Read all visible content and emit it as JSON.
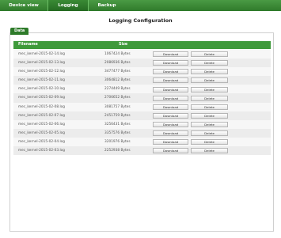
{
  "nav": {
    "tabs": [
      {
        "label": "Device view"
      },
      {
        "label": "Logging"
      },
      {
        "label": "Backup"
      }
    ]
  },
  "page": {
    "title": "Logging Configuration"
  },
  "panel": {
    "tab_label": "Data"
  },
  "table": {
    "headers": {
      "filename": "Filename",
      "size": "Size"
    },
    "download_label": "Download",
    "delete_label": "Delete",
    "rows": [
      {
        "filename": "mec_kernel-2015-02-14.log",
        "size": "1067424 Bytes"
      },
      {
        "filename": "mec_kernel-2015-02-13.log",
        "size": "2086936 Bytes"
      },
      {
        "filename": "mec_kernel-2015-02-12.log",
        "size": "3477477 Bytes"
      },
      {
        "filename": "mec_kernel-2015-02-11.log",
        "size": "3064812 Bytes"
      },
      {
        "filename": "mec_kernel-2015-02-10.log",
        "size": "2274449 Bytes"
      },
      {
        "filename": "mec_kernel-2015-02-09.log",
        "size": "2706652 Bytes"
      },
      {
        "filename": "mec_kernel-2015-02-08.log",
        "size": "3081757 Bytes"
      },
      {
        "filename": "mec_kernel-2015-02-07.log",
        "size": "2451759 Bytes"
      },
      {
        "filename": "mec_kernel-2015-02-06.log",
        "size": "3256431 Bytes"
      },
      {
        "filename": "mec_kernel-2015-02-05.log",
        "size": "3357576 Bytes"
      },
      {
        "filename": "mec_kernel-2015-02-04.log",
        "size": "3201976 Bytes"
      },
      {
        "filename": "mec_kernel-2015-02-03.log",
        "size": "2252938 Bytes"
      }
    ]
  },
  "colors": {
    "nav": "#2f7a2b",
    "header": "#3f9a3b",
    "panel_tab": "#2e7b2a"
  }
}
